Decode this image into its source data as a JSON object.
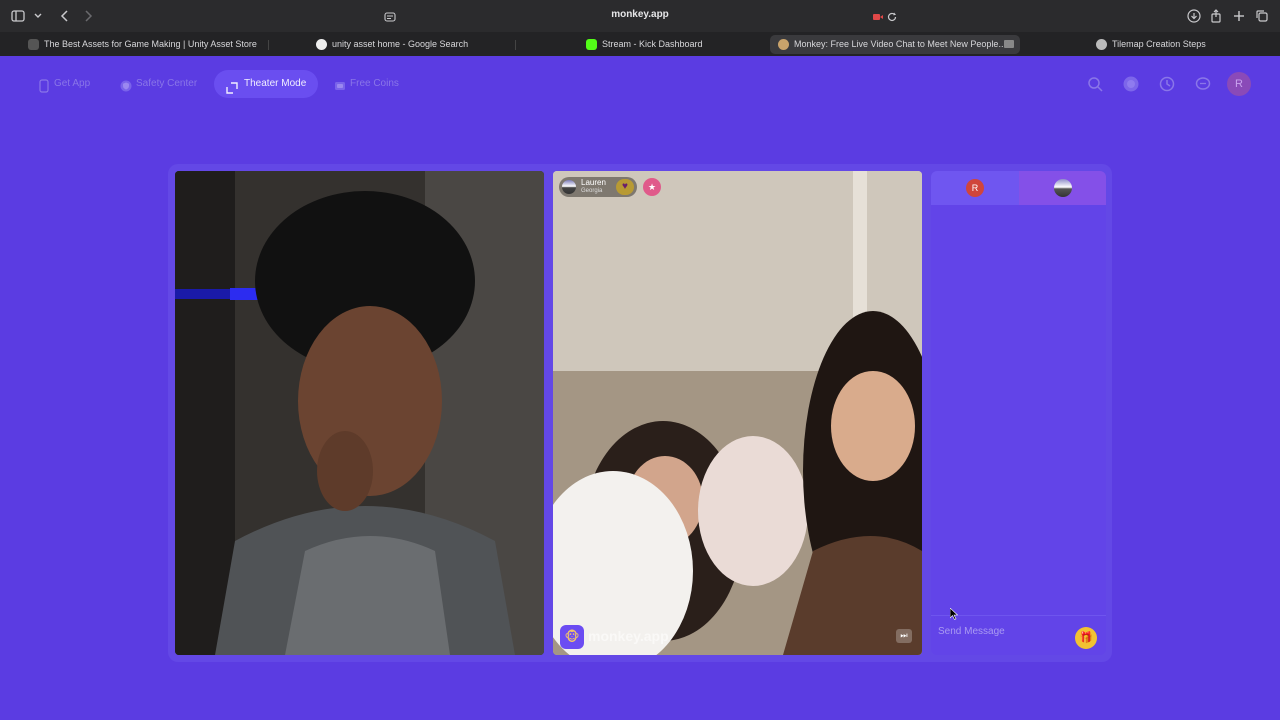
{
  "browser": {
    "url": "monkey.app",
    "tabs": [
      {
        "label": "The Best Assets for Game Making | Unity Asset Store",
        "active": false
      },
      {
        "label": "unity asset home - Google Search",
        "active": false
      },
      {
        "label": "Stream - Kick Dashboard",
        "active": false
      },
      {
        "label": "Monkey: Free Live Video Chat to Meet New People...",
        "active": true
      },
      {
        "label": "Tilemap Creation Steps",
        "active": false
      }
    ]
  },
  "nav": {
    "get_app": "Get App",
    "safety_center": "Safety Center",
    "theater_mode": "Theater Mode",
    "free_coins": "Free Coins",
    "avatar_initial": "R"
  },
  "peer": {
    "name": "Lauren",
    "location": "Georgia"
  },
  "watermark": "monkey.app",
  "chat": {
    "self_initial": "R",
    "placeholder": "Send Message"
  },
  "colors": {
    "background": "#5b3ce2",
    "accent": "#6a4ef0",
    "gift": "#f2c232"
  }
}
